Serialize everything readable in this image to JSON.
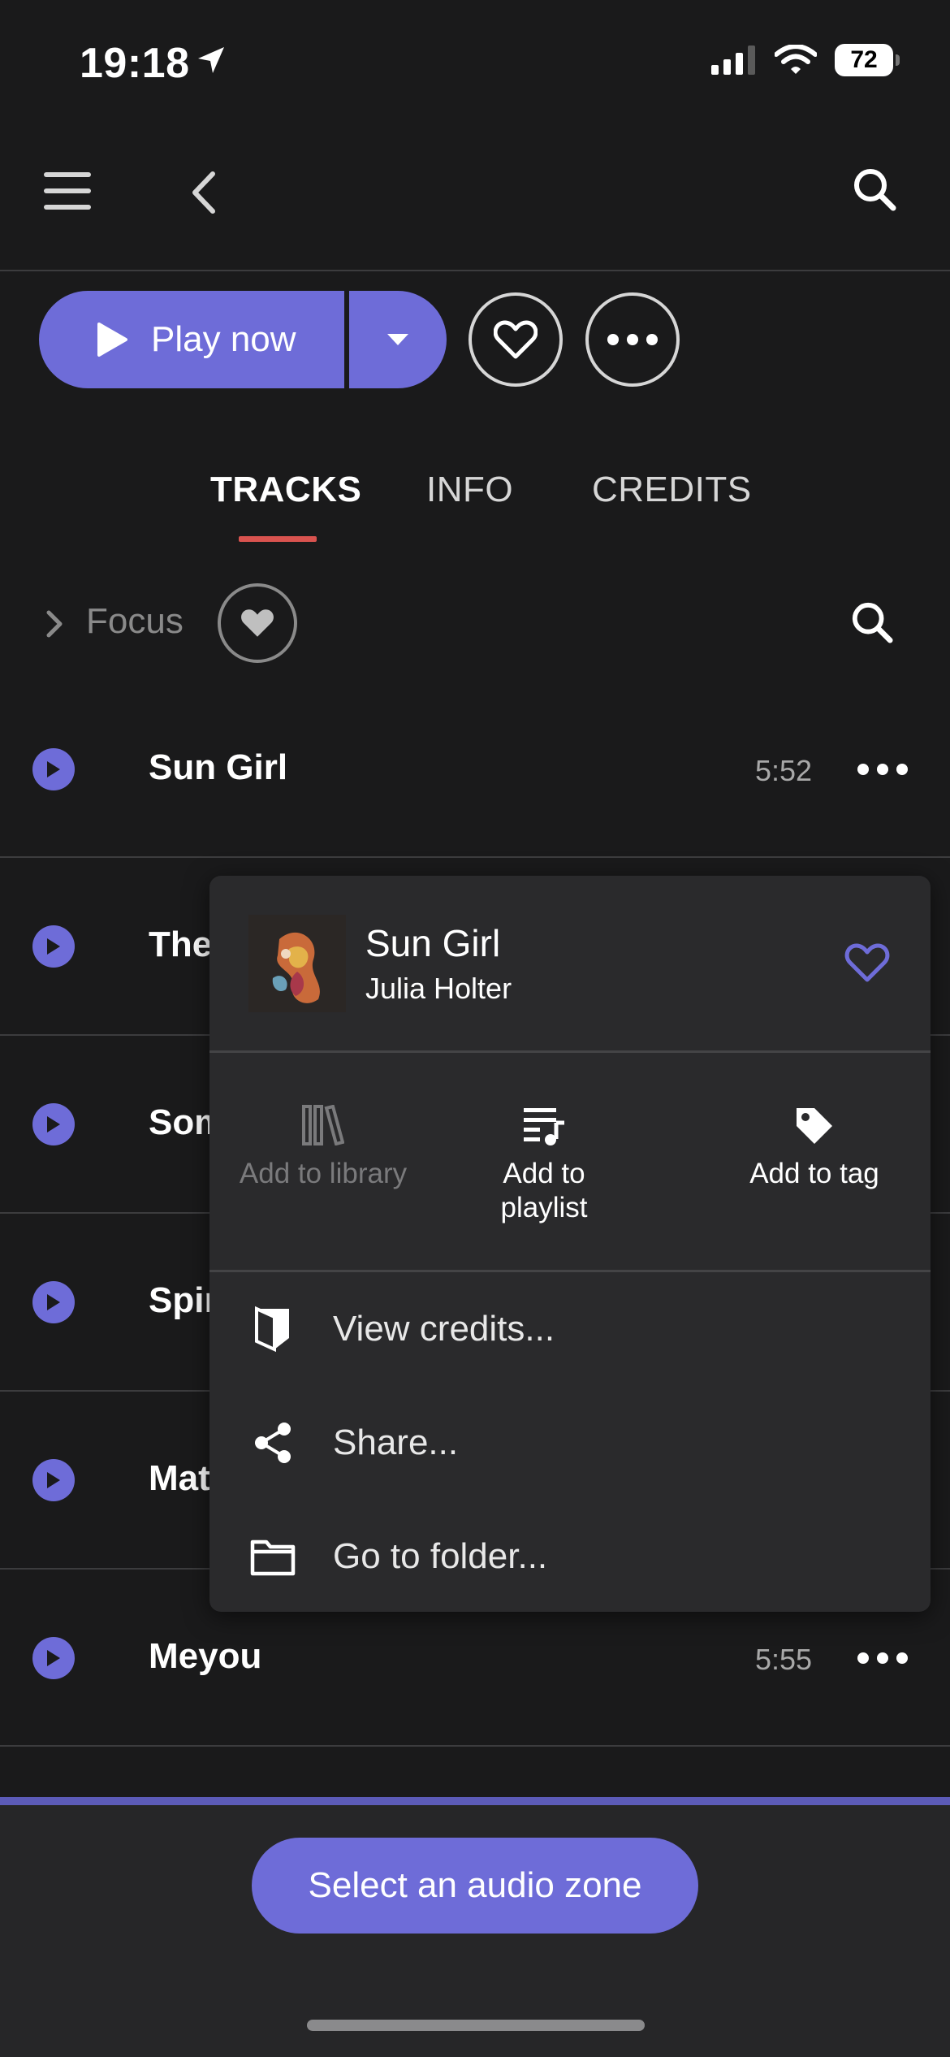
{
  "status": {
    "time": "19:18",
    "battery": "72"
  },
  "header": {
    "menu_icon": "hamburger-icon",
    "back_icon": "chevron-left-icon",
    "search_icon": "search-icon"
  },
  "actions": {
    "play_label": "Play now"
  },
  "tabs": [
    {
      "label": "TRACKS",
      "active": true
    },
    {
      "label": "INFO",
      "active": false
    },
    {
      "label": "CREDITS",
      "active": false
    }
  ],
  "filter": {
    "label": "Focus"
  },
  "tracks": [
    {
      "title": "Sun Girl",
      "duration": "5:52"
    },
    {
      "title": "The",
      "duration": ""
    },
    {
      "title": "Som",
      "duration": ""
    },
    {
      "title": "Spir",
      "duration": ""
    },
    {
      "title": "Mat",
      "duration": ""
    },
    {
      "title": "Meyou",
      "duration": "5:55"
    }
  ],
  "popup": {
    "title": "Sun Girl",
    "artist": "Julia Holter",
    "actions": [
      {
        "label": "Add to library",
        "enabled": false,
        "icon": "library-icon"
      },
      {
        "label": "Add to playlist",
        "enabled": true,
        "icon": "playlist-add-icon"
      },
      {
        "label": "Add to tag",
        "enabled": true,
        "icon": "tag-icon"
      }
    ],
    "menu": [
      {
        "label": "View credits...",
        "icon": "credits-icon"
      },
      {
        "label": "Share...",
        "icon": "share-icon"
      },
      {
        "label": "Go to folder...",
        "icon": "folder-icon"
      }
    ]
  },
  "footer": {
    "zone_label": "Select an audio zone"
  },
  "colors": {
    "accent": "#6e6cd8",
    "tab_underline": "#d9534f",
    "background": "#1a1a1b",
    "popup": "#2a2a2c"
  }
}
